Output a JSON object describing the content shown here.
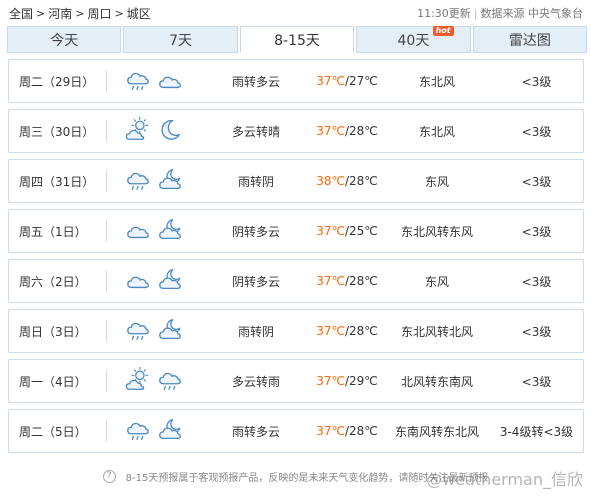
{
  "breadcrumb": {
    "items": [
      "全国",
      "河南",
      "周口",
      "城区"
    ],
    "separator": ">"
  },
  "update": {
    "time": "11:30更新",
    "source": "数据来源 中央气象台"
  },
  "tabs": [
    {
      "label": "今天"
    },
    {
      "label": "7天"
    },
    {
      "label": "8-15天"
    },
    {
      "label": "40天",
      "badge": "hot"
    },
    {
      "label": "雷达图"
    }
  ],
  "active_tab": "8-15天",
  "days": [
    {
      "date": "周二（29日）",
      "icon_day": "cloud-rain-icon",
      "icon_night": "cloud-icon",
      "desc": "雨转多云",
      "high": "37℃",
      "low": "/27℃",
      "wind": "东北风",
      "level": "<3级"
    },
    {
      "date": "周三（30日）",
      "icon_day": "partly-cloudy-day-icon",
      "icon_night": "moon-icon",
      "desc": "多云转晴",
      "high": "37℃",
      "low": "/28℃",
      "wind": "东北风",
      "level": "<3级"
    },
    {
      "date": "周四（31日）",
      "icon_day": "cloud-rain-icon",
      "icon_night": "cloud-moon-icon",
      "desc": "雨转阴",
      "high": "38℃",
      "low": "/28℃",
      "wind": "东风",
      "level": "<3级"
    },
    {
      "date": "周五（1日）",
      "icon_day": "cloud-icon",
      "icon_night": "cloud-moon-icon",
      "desc": "阴转多云",
      "high": "37℃",
      "low": "/25℃",
      "wind": "东北风转东风",
      "level": "<3级"
    },
    {
      "date": "周六（2日）",
      "icon_day": "cloud-icon",
      "icon_night": "cloud-moon-icon",
      "desc": "阴转多云",
      "high": "37℃",
      "low": "/28℃",
      "wind": "东风",
      "level": "<3级"
    },
    {
      "date": "周日（3日）",
      "icon_day": "cloud-rain-icon",
      "icon_night": "cloud-moon-icon",
      "desc": "雨转阴",
      "high": "37℃",
      "low": "/28℃",
      "wind": "东北风转北风",
      "level": "<3级"
    },
    {
      "date": "周一（4日）",
      "icon_day": "partly-cloudy-day-icon",
      "icon_night": "cloud-rain-icon",
      "desc": "多云转雨",
      "high": "37℃",
      "low": "/29℃",
      "wind": "北风转东南风",
      "level": "<3级"
    },
    {
      "date": "周二（5日）",
      "icon_day": "cloud-rain-icon",
      "icon_night": "cloud-moon-icon",
      "desc": "雨转多云",
      "high": "37℃",
      "low": "/28℃",
      "wind": "东南风转东北风",
      "level": "3-4级转<3级"
    }
  ],
  "footer": {
    "note": "8-15天预报属于客观预报产品，反映的是未来天气变化趋势，请随时关注最新预报",
    "watermark": "@weatherman_信欣"
  },
  "colors": {
    "high_temp": "#ff6600",
    "tab_bg": "#e4eef7",
    "border": "#cfdbe7",
    "icon_stroke": "#4a88c2",
    "icon_fill": "#eef5fc",
    "hot_badge": "#f25c2b"
  }
}
